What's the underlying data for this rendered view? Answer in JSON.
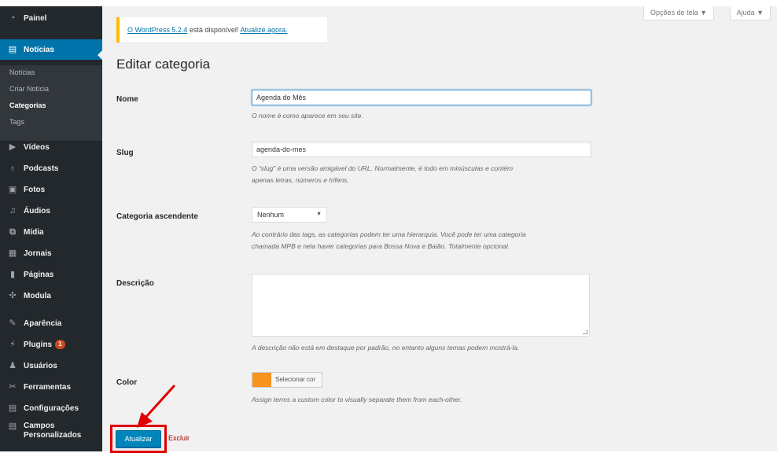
{
  "sidebar": {
    "top_items": [
      {
        "label": "Painel",
        "icon": "dashboard-icon"
      },
      {
        "label": "Notícias",
        "icon": "posts-icon",
        "active": true
      }
    ],
    "submenu": [
      {
        "label": "Notícias"
      },
      {
        "label": "Criar Notícia"
      },
      {
        "label": "Categorias",
        "current": true
      },
      {
        "label": "Tags"
      }
    ],
    "items": [
      {
        "label": "Vídeos",
        "icon": "video-icon"
      },
      {
        "label": "Podcasts",
        "icon": "microphone-icon"
      },
      {
        "label": "Fotos",
        "icon": "image-icon"
      },
      {
        "label": "Áudios",
        "icon": "music-icon"
      },
      {
        "label": "Mídia",
        "icon": "media-icon"
      },
      {
        "label": "Jornais",
        "icon": "newspaper-icon"
      },
      {
        "label": "Páginas",
        "icon": "pages-icon"
      },
      {
        "label": "Modula",
        "icon": "gallery-icon"
      },
      {
        "label": "Aparência",
        "icon": "brush-icon"
      },
      {
        "label": "Plugins",
        "icon": "plugin-icon",
        "badge": "1"
      },
      {
        "label": "Usuários",
        "icon": "users-icon"
      },
      {
        "label": "Ferramentas",
        "icon": "wrench-icon"
      },
      {
        "label": "Configurações",
        "icon": "settings-icon"
      },
      {
        "label": "Campos Personalizados",
        "icon": "custom-fields-icon"
      }
    ]
  },
  "header": {
    "screen_options": "Opções de tela ▼",
    "help": "Ajuda ▼"
  },
  "notice": {
    "link_version": "O WordPress 5.2.4",
    "text": "está disponível!",
    "link_update": "Atualize agora."
  },
  "page": {
    "title": "Editar categoria"
  },
  "form": {
    "name_label": "Nome",
    "name_value": "Agenda do Mês",
    "name_desc": "O nome é como aparece em seu site.",
    "slug_label": "Slug",
    "slug_value": "agenda-do-mes",
    "slug_desc_1": "O “slug” é uma versão amigável do URL. Normalmente, é todo em minúsculas e contém",
    "slug_desc_2": "apenas letras, números e hífens.",
    "parent_label": "Categoria ascendente",
    "parent_value": "Nenhum",
    "parent_desc_1": "Ao contrário das tags, as categorias podem ter uma hierarquia. Você pode ter uma categoria",
    "parent_desc_2": "chamada MPB e nela haver categorias para Bossa Nova e Baião. Totalmente opcional.",
    "description_label": "Descrição",
    "description_desc": "A descrição não está em destaque por padrão, no entanto alguns temas podem mostrá-la.",
    "color_label": "Color",
    "color_value": "#f7941d",
    "color_button": "Selecionar cor",
    "color_desc": "Assign terms a custom color to visually separate them from each-other.",
    "update_button": "Atualizar",
    "delete_link": "Excluir"
  },
  "annotation": {
    "highlight_color": "#e00000"
  }
}
